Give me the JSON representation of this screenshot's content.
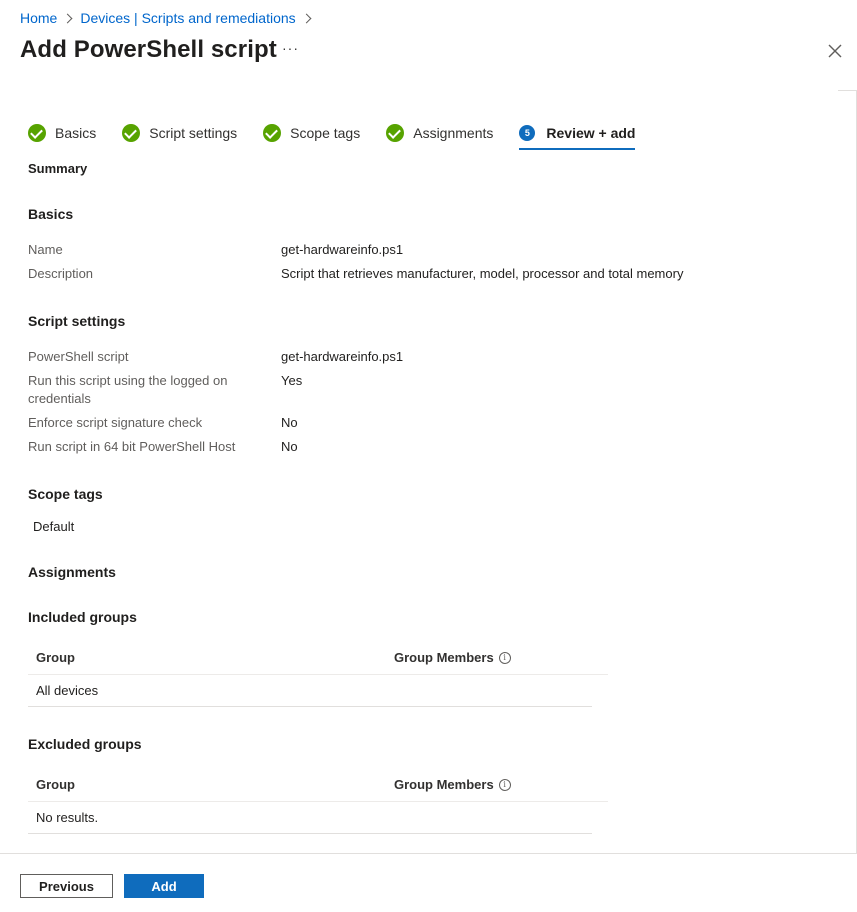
{
  "breadcrumb": {
    "home": "Home",
    "devices": "Devices | Scripts and remediations"
  },
  "title": "Add PowerShell script",
  "more": "···",
  "tabs": [
    {
      "label": "Basics",
      "state": "complete"
    },
    {
      "label": "Script settings",
      "state": "complete"
    },
    {
      "label": "Scope tags",
      "state": "complete"
    },
    {
      "label": "Assignments",
      "state": "complete"
    },
    {
      "label": "Review + add",
      "state": "active",
      "step": "5"
    }
  ],
  "summary": "Summary",
  "basics": {
    "heading": "Basics",
    "name_label": "Name",
    "name_value": "get-hardwareinfo.ps1",
    "description_label": "Description",
    "description_value": "Script that retrieves manufacturer, model, processor and total memory"
  },
  "script_settings": {
    "heading": "Script settings",
    "rows": [
      {
        "label": "PowerShell script",
        "value": "get-hardwareinfo.ps1"
      },
      {
        "label": "Run this script using the logged on credentials",
        "value": "Yes"
      },
      {
        "label": "Enforce script signature check",
        "value": "No"
      },
      {
        "label": "Run script in 64 bit PowerShell Host",
        "value": "No"
      }
    ]
  },
  "scope_tags": {
    "heading": "Scope tags",
    "value": "Default"
  },
  "assignments": {
    "heading": "Assignments",
    "included": {
      "heading": "Included groups",
      "col_group": "Group",
      "col_members": "Group Members",
      "row": "All devices"
    },
    "excluded": {
      "heading": "Excluded groups",
      "col_group": "Group",
      "col_members": "Group Members",
      "row": "No results."
    }
  },
  "footer": {
    "previous": "Previous",
    "add": "Add"
  },
  "colors": {
    "accent": "#0f6cbd",
    "success": "#57a300",
    "link": "#0066cc"
  }
}
